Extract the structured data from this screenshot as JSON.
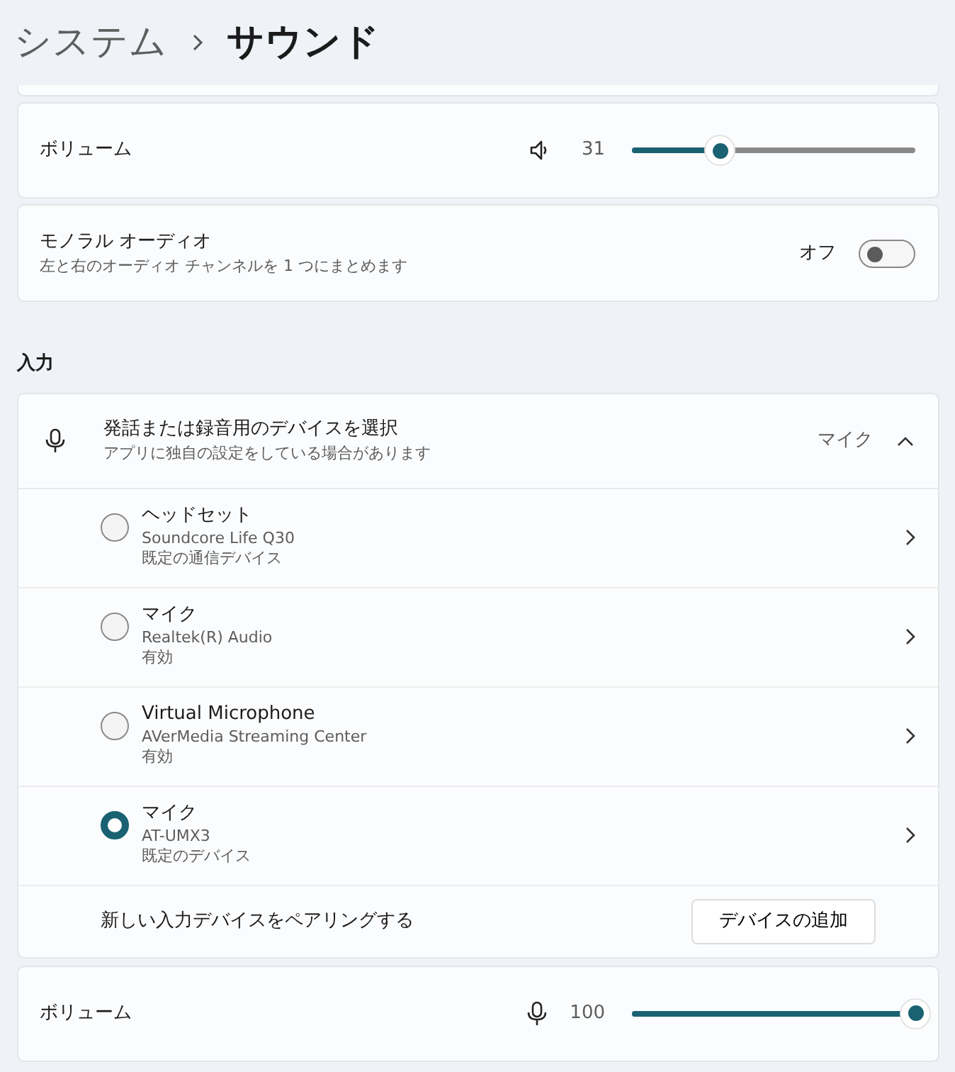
{
  "breadcrumb": {
    "parent": "システム",
    "current": "サウンド"
  },
  "output_volume": {
    "label": "ボリューム",
    "reading": "31",
    "level": 0.31
  },
  "mono_audio": {
    "title": "モノラル オーディオ",
    "description": "左と右のオーディオ チャンネルを 1 つにまとめます",
    "state_label": "オフ",
    "on": false
  },
  "input": {
    "heading": "入力",
    "device_select": {
      "title": "発話または録音用のデバイスを選択",
      "description": "アプリに独自の設定をしている場合があります",
      "value": "マイク",
      "expanded": true
    },
    "devices": [
      {
        "name": "ヘッドセット",
        "detail": "Soundcore Life Q30",
        "status": "既定の通信デバイス",
        "selected": false
      },
      {
        "name": "マイク",
        "detail": "Realtek(R) Audio",
        "status": "有効",
        "selected": false
      },
      {
        "name": "Virtual Microphone",
        "detail": "AVerMedia Streaming Center",
        "status": "有効",
        "selected": false
      },
      {
        "name": "マイク",
        "detail": "AT-UMX3",
        "status": "既定のデバイス",
        "selected": true
      }
    ],
    "pair": {
      "label": "新しい入力デバイスをペアリングする",
      "button": "デバイスの追加"
    }
  },
  "input_volume": {
    "label": "ボリューム",
    "reading": "100",
    "level": 1.0
  }
}
